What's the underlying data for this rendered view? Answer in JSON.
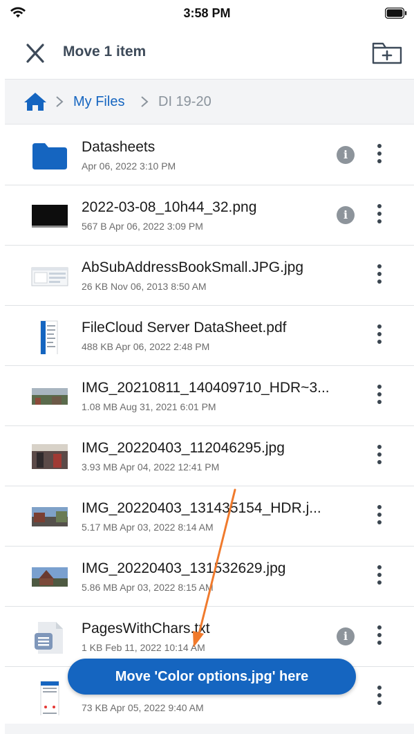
{
  "status_bar": {
    "time": "3:58 PM"
  },
  "header": {
    "title": "Move 1 item"
  },
  "breadcrumb": {
    "root": "My Files",
    "current": "DI 19-20"
  },
  "files": [
    {
      "name": "Datasheets",
      "meta": " Apr 06, 2022 3:10 PM",
      "thumb": "folder",
      "info": true
    },
    {
      "name": "2022-03-08_10h44_32.png",
      "meta": "567 B Apr 06, 2022 3:09 PM",
      "thumb": "black-image",
      "info": true
    },
    {
      "name": "AbSubAddressBookSmall.JPG.jpg",
      "meta": "26 KB Nov 06, 2013 8:50 AM",
      "thumb": "screenshot",
      "info": false
    },
    {
      "name": "FileCloud Server DataSheet.pdf",
      "meta": "488 KB Apr 06, 2022 2:48 PM",
      "thumb": "pdf",
      "info": false
    },
    {
      "name": "IMG_20210811_140409710_HDR~3...",
      "meta": "1.08 MB Aug 31, 2021 6:01 PM",
      "thumb": "photo-landscape",
      "info": false
    },
    {
      "name": "IMG_20220403_112046295.jpg",
      "meta": "3.93 MB Apr 04, 2022 12:41 PM",
      "thumb": "photo-store",
      "info": false
    },
    {
      "name": "IMG_20220403_131435154_HDR.j...",
      "meta": "5.17 MB Apr 03, 2022 8:14 AM",
      "thumb": "photo-street",
      "info": false
    },
    {
      "name": "IMG_20220403_131532629.jpg",
      "meta": "5.86 MB Apr 03, 2022 8:15 AM",
      "thumb": "photo-house",
      "info": false
    },
    {
      "name": "PagesWithChars.txt",
      "meta": "1 KB Feb 11, 2022 10:14 AM",
      "thumb": "text-file",
      "info": true
    },
    {
      "name": "",
      "meta": "73 KB Apr 05, 2022 9:40 AM",
      "thumb": "phone-screenshot",
      "info": false
    }
  ],
  "move_button": {
    "label": "Move 'Color options.jpg' here"
  },
  "colors": {
    "accent": "#1565c0",
    "annotation": "#f07a2c"
  },
  "icons": {
    "close": "close-icon",
    "new_folder": "folder-plus-icon",
    "home": "home-icon",
    "info": "info-icon",
    "more": "more-vertical-icon"
  }
}
